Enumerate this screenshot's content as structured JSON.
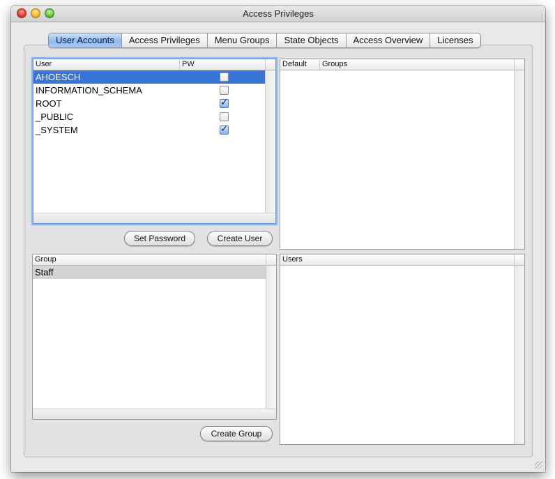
{
  "window": {
    "title": "Access Privileges"
  },
  "tabs": [
    {
      "label": "User Accounts",
      "active": true
    },
    {
      "label": "Access Privileges",
      "active": false
    },
    {
      "label": "Menu Groups",
      "active": false
    },
    {
      "label": "State Objects",
      "active": false
    },
    {
      "label": "Access Overview",
      "active": false
    },
    {
      "label": "Licenses",
      "active": false
    }
  ],
  "users_table": {
    "headers": {
      "user": "User",
      "pw": "PW"
    },
    "rows": [
      {
        "name": "AHOESCH",
        "pw": false,
        "selected": true
      },
      {
        "name": "INFORMATION_SCHEMA",
        "pw": false,
        "selected": false
      },
      {
        "name": "ROOT",
        "pw": true,
        "selected": false
      },
      {
        "name": "_PUBLIC",
        "pw": false,
        "selected": false
      },
      {
        "name": "_SYSTEM",
        "pw": true,
        "selected": false
      }
    ]
  },
  "default_groups_table": {
    "headers": {
      "default": "Default",
      "groups": "Groups"
    }
  },
  "buttons": {
    "set_password": "Set Password",
    "create_user": "Create User",
    "create_group": "Create Group"
  },
  "group_table": {
    "headers": {
      "group": "Group"
    },
    "rows": [
      {
        "name": "Staff",
        "selected": true
      }
    ]
  },
  "users_of_group_table": {
    "headers": {
      "users": "Users"
    }
  },
  "colors": {
    "selection_blue": "#3875d7",
    "selection_gray": "#d4d4d4",
    "tab_active": "#8eb9ef"
  }
}
